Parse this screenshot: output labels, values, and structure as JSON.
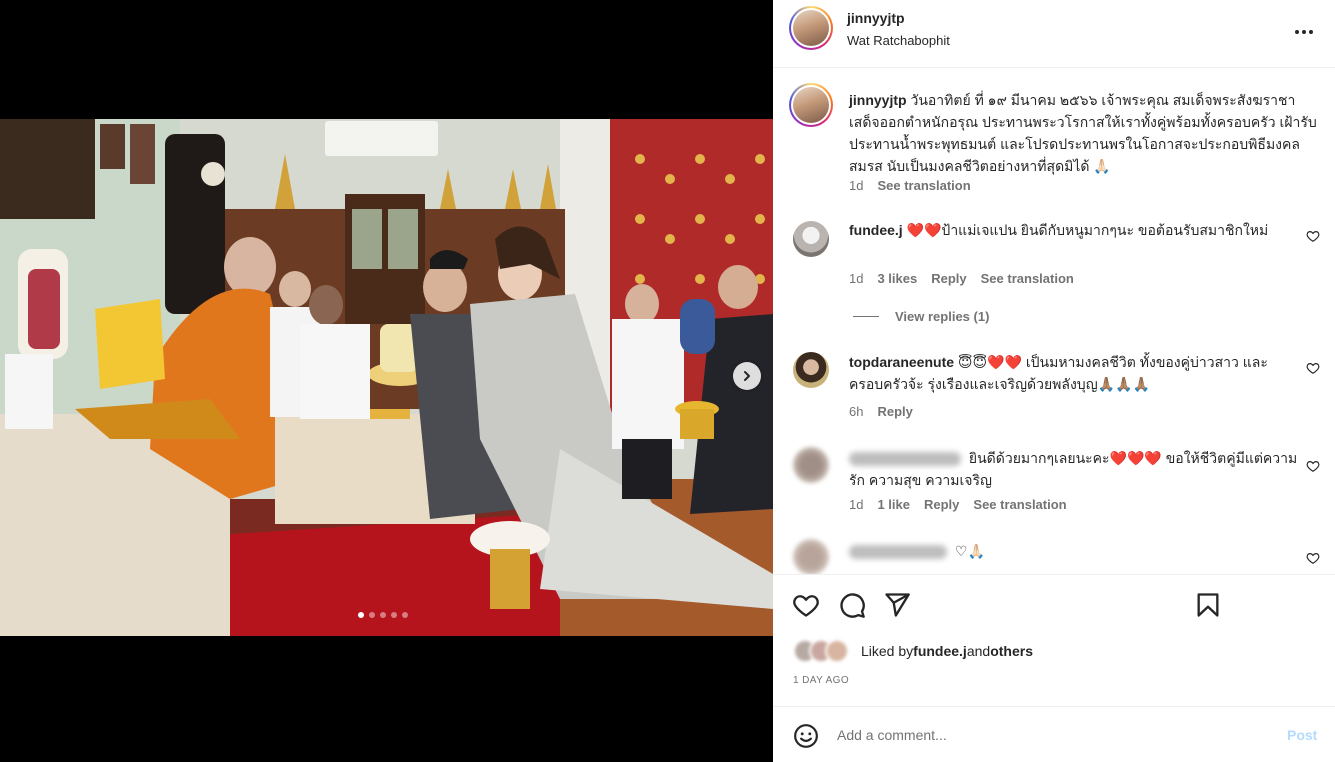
{
  "post": {
    "username": "jinnyyjtp",
    "location": "Wat Ratchabophit",
    "carousel": {
      "slide_count": 5,
      "active_index": 0
    }
  },
  "caption": {
    "username": "jinnyyjtp",
    "text": "วันอาทิตย์ ที่ ๑๙ มีนาคม ๒๕๖๖ เจ้าพระคุณ สมเด็จพระสังฆราชาเสด็จออกตำหนักอรุณ ประทานพระวโรกาสให้เราทั้งคู่พร้อมทั้งครอบครัว เฝ้ารับประทานน้ำพระพุทธมนต์ และโปรดประทานพรในโอกาสจะประกอบพิธีมงคลสมรส นับเป็นมงคลชีวิตอย่างหาที่สุดมิได้ 🙏🏻",
    "time": "1d",
    "see_translation": "See translation"
  },
  "comments": [
    {
      "username": "fundee.j",
      "text": "❤️❤️ป้าแม่เจแปน ยินดีกับหนูมากๆนะ ขอต้อนรับสมาชิกใหม่",
      "time": "1d",
      "likes": "3 likes",
      "reply": "Reply",
      "see_translation": "See translation",
      "view_replies": "View replies (1)"
    },
    {
      "username": "topdaraneenute",
      "text": "😇😇❤️❤️ เป็นมหามงคลชีวิต ทั้งของคู่บ่าวสาว และครอบครัวจ้ะ รุ่งเรืองและเจริญด้วยพลังบุญ🙏🏽🙏🏽🙏🏽",
      "time": "6h",
      "reply": "Reply"
    },
    {
      "username": "",
      "text": "ยินดีด้วยมากๆเลยนะคะ❤️❤️❤️ ขอให้ชีวิตคู่มีแต่ความรัก ความสุข ความเจริญ",
      "time": "1d",
      "likes": "1 like",
      "reply": "Reply",
      "see_translation": "See translation"
    },
    {
      "username": "",
      "text": "♡🙏🏻"
    }
  ],
  "liked_by": {
    "prefix": "Liked by ",
    "user": "fundee.j",
    "middle": " and ",
    "others": "others"
  },
  "date": "1 DAY AGO",
  "add_comment": {
    "placeholder": "Add a comment...",
    "post_label": "Post"
  },
  "icons": {
    "more": "more-horizontal-icon",
    "like": "heart-icon",
    "comment": "comment-icon",
    "share": "share-icon",
    "save": "bookmark-icon",
    "emoji": "emoji-icon",
    "next": "chevron-right-icon"
  },
  "colors": {
    "link_disabled": "#b3dbff",
    "secondary_text": "#737373",
    "primary_text": "#262626"
  }
}
